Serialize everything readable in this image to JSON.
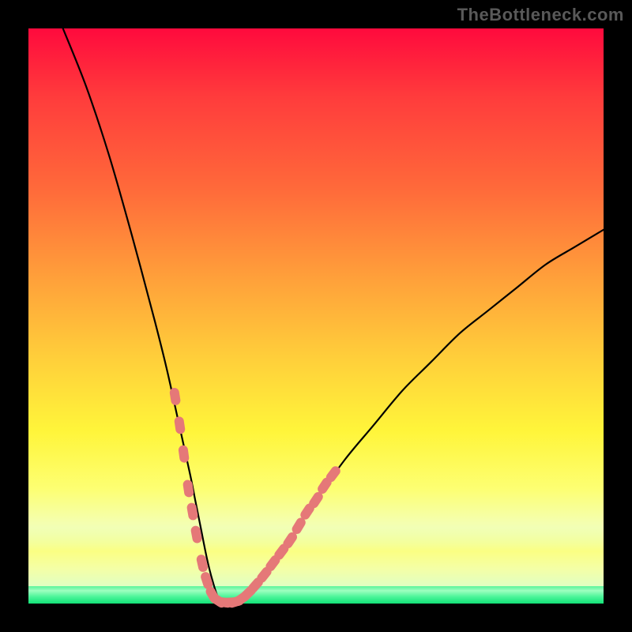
{
  "watermark": "TheBottleneck.com",
  "chart_data": {
    "type": "line",
    "title": "",
    "xlabel": "",
    "ylabel": "",
    "xlim": [
      0,
      100
    ],
    "ylim": [
      0,
      100
    ],
    "series": [
      {
        "name": "bottleneck-curve",
        "x": [
          6,
          10,
          14,
          18,
          22,
          24,
          26,
          28,
          29,
          30,
          31,
          32,
          33,
          34,
          35,
          36,
          37,
          38,
          40,
          42,
          44,
          46,
          50,
          55,
          60,
          65,
          70,
          75,
          80,
          85,
          90,
          95,
          100
        ],
        "y": [
          100,
          90,
          78,
          64,
          49,
          41,
          32,
          23,
          18,
          13,
          8,
          4,
          1,
          0,
          0,
          0,
          0,
          1,
          3,
          6,
          9,
          12,
          18,
          25,
          31,
          37,
          42,
          47,
          51,
          55,
          59,
          62,
          65
        ]
      }
    ],
    "markers": {
      "name": "highlight-beads",
      "color": "#e57878",
      "points": [
        {
          "x": 25.5,
          "y": 36
        },
        {
          "x": 26.3,
          "y": 31
        },
        {
          "x": 27.0,
          "y": 26
        },
        {
          "x": 27.8,
          "y": 20
        },
        {
          "x": 28.5,
          "y": 16
        },
        {
          "x": 29.2,
          "y": 12
        },
        {
          "x": 30.2,
          "y": 7
        },
        {
          "x": 31.0,
          "y": 4
        },
        {
          "x": 32.0,
          "y": 1.5
        },
        {
          "x": 33.0,
          "y": 0.5
        },
        {
          "x": 34.0,
          "y": 0.2
        },
        {
          "x": 35.0,
          "y": 0.2
        },
        {
          "x": 36.0,
          "y": 0.3
        },
        {
          "x": 37.0,
          "y": 0.8
        },
        {
          "x": 38.2,
          "y": 1.8
        },
        {
          "x": 39.5,
          "y": 3.2
        },
        {
          "x": 41.0,
          "y": 5
        },
        {
          "x": 42.5,
          "y": 7
        },
        {
          "x": 44.0,
          "y": 9
        },
        {
          "x": 45.5,
          "y": 11
        },
        {
          "x": 47.0,
          "y": 13.5
        },
        {
          "x": 48.5,
          "y": 16
        },
        {
          "x": 50.0,
          "y": 18
        },
        {
          "x": 51.5,
          "y": 20.5
        },
        {
          "x": 53.0,
          "y": 22.5
        }
      ]
    },
    "colors": {
      "gradient_top": "#ff0a3d",
      "gradient_mid": "#fff53a",
      "gradient_bottom": "#16e47a",
      "curve": "#000000",
      "marker": "#e57878"
    }
  }
}
